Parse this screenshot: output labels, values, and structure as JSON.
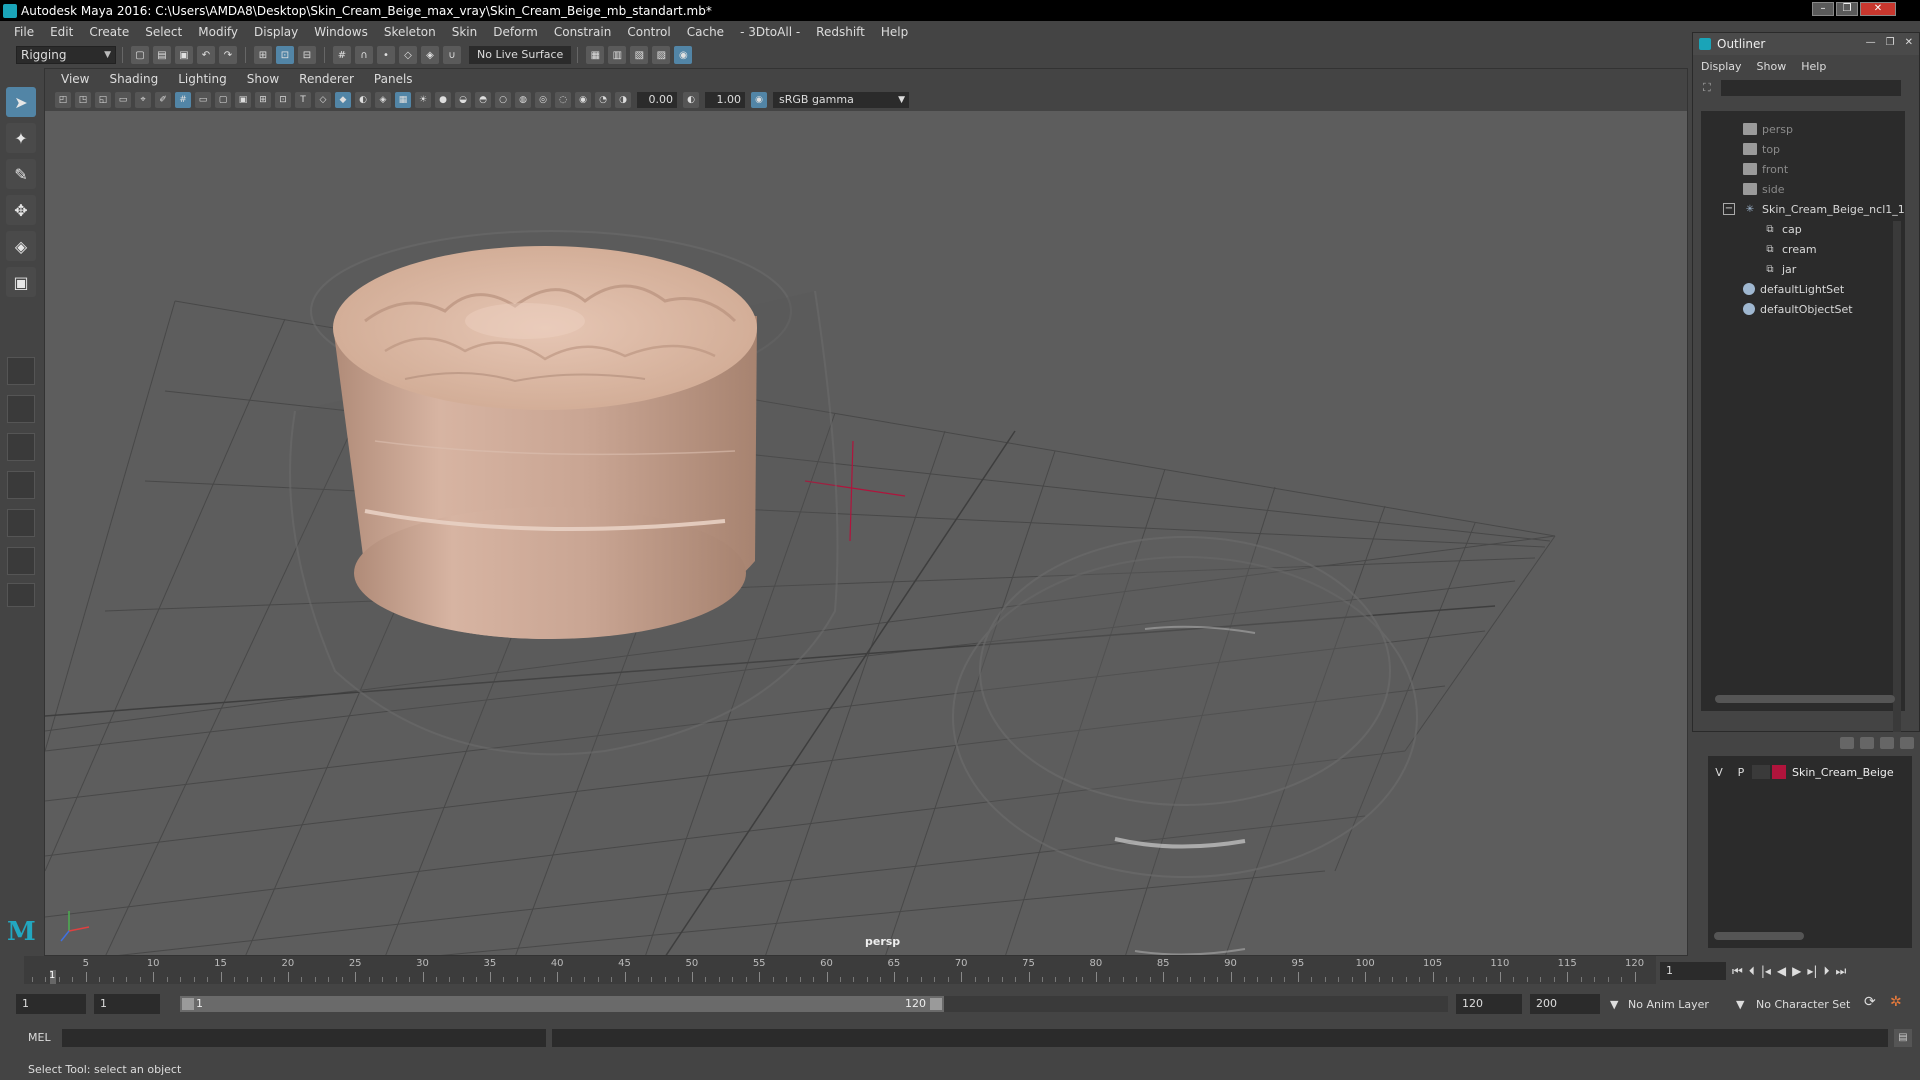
{
  "window": {
    "title": "Autodesk Maya 2016: C:\\Users\\AMDA8\\Desktop\\Skin_Cream_Beige_max_vray\\Skin_Cream_Beige_mb_standart.mb*"
  },
  "menubar": [
    "File",
    "Edit",
    "Create",
    "Select",
    "Modify",
    "Display",
    "Windows",
    "Skeleton",
    "Skin",
    "Deform",
    "Constrain",
    "Control",
    "Cache",
    "- 3DtoAll -",
    "Redshift",
    "Help"
  ],
  "statusline": {
    "mode": "Rigging",
    "live_surface": "No Live Surface"
  },
  "viewport": {
    "panel_menu": [
      "View",
      "Shading",
      "Lighting",
      "Show",
      "Renderer",
      "Panels"
    ],
    "exposure": "0.00",
    "gamma_value": "1.00",
    "color_space": "sRGB gamma",
    "camera_label": "persp"
  },
  "outliner": {
    "title": "Outliner",
    "menu": [
      "Display",
      "Show",
      "Help"
    ],
    "items": [
      {
        "name": "persp",
        "type": "camera"
      },
      {
        "name": "top",
        "type": "camera"
      },
      {
        "name": "front",
        "type": "camera"
      },
      {
        "name": "side",
        "type": "camera"
      },
      {
        "name": "Skin_Cream_Beige_ncl1_1",
        "type": "group"
      },
      {
        "name": "cap",
        "type": "mesh"
      },
      {
        "name": "cream",
        "type": "mesh"
      },
      {
        "name": "jar",
        "type": "mesh"
      },
      {
        "name": "defaultLightSet",
        "type": "set"
      },
      {
        "name": "defaultObjectSet",
        "type": "set"
      }
    ]
  },
  "layers": {
    "rows": [
      {
        "v": "V",
        "p": "P",
        "name": "Skin_Cream_Beige",
        "color": "#b0143c"
      }
    ]
  },
  "timeslider": {
    "ticks": [
      5,
      10,
      15,
      20,
      25,
      30,
      35,
      40,
      45,
      50,
      55,
      60,
      65,
      70,
      75,
      80,
      85,
      90,
      95,
      100,
      105,
      110,
      115,
      120
    ],
    "current_frame": "1",
    "current_frame_field": "1"
  },
  "range": {
    "start": "1",
    "playback_start": "1",
    "slider_start": "1",
    "slider_end": "120",
    "playback_end": "120",
    "end": "200",
    "anim_layer": "No Anim Layer",
    "character_set": "No Character Set"
  },
  "cmdline": {
    "label": "MEL"
  },
  "helpline": {
    "text": "Select Tool: select an object"
  },
  "colors": {
    "accent": "#5285a6",
    "maya_teal": "#1aa4b8",
    "jar_color": "#c9a593",
    "layer_red": "#b0143c",
    "grid_axis_red": "#b0143c"
  }
}
